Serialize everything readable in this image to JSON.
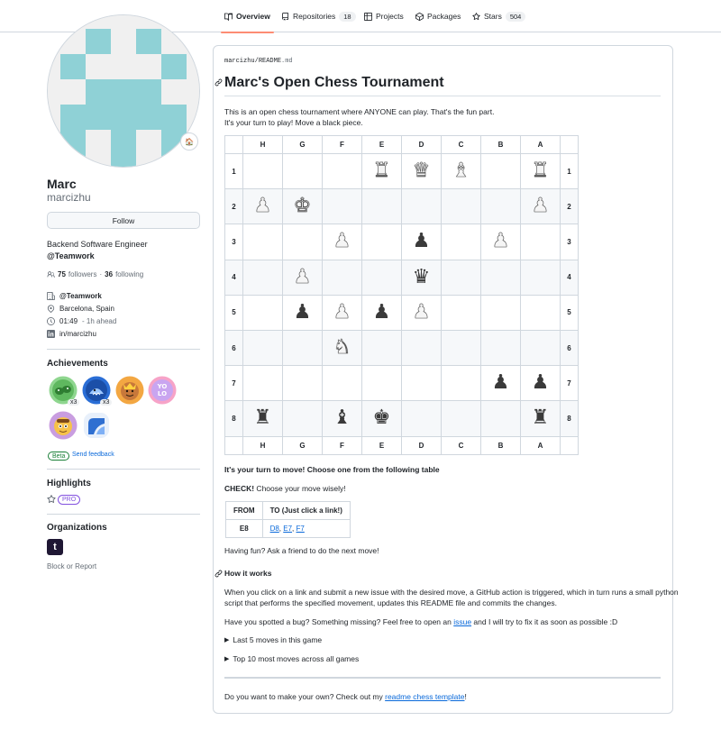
{
  "nav": {
    "tabs": [
      {
        "label": "Overview",
        "count": null
      },
      {
        "label": "Repositories",
        "count": "18"
      },
      {
        "label": "Projects",
        "count": null
      },
      {
        "label": "Packages",
        "count": null
      },
      {
        "label": "Stars",
        "count": "504"
      }
    ]
  },
  "profile": {
    "avatar_emoji": "🏠",
    "name": "Marc",
    "login": "marcizhu",
    "follow_label": "Follow",
    "bio_line1": "Backend Software Engineer",
    "bio_line2": "@Teamwork",
    "followers_count": "75",
    "followers_label": "followers",
    "dot": "·",
    "following_count": "36",
    "following_label": "following",
    "company": "@Teamwork",
    "location": "Barcelona, Spain",
    "time": "01:49",
    "time_note": "- 1h ahead",
    "linkedin": "in/marcizhu"
  },
  "achievements": {
    "title": "Achievements",
    "badges": [
      {
        "name": "pair-extraordinaire",
        "count": "x3"
      },
      {
        "name": "pull-shark",
        "count": "x3"
      },
      {
        "name": "starstruck",
        "count": null
      },
      {
        "name": "yolo",
        "count": null
      },
      {
        "name": "quickdraw",
        "count": null
      },
      {
        "name": "arctic-code-vault",
        "count": null
      }
    ],
    "beta_label": "Beta",
    "feedback_label": "Send feedback"
  },
  "highlights": {
    "title": "Highlights",
    "pro_label": "PRO"
  },
  "organizations": {
    "title": "Organizations",
    "org_initial": "t",
    "block_label": "Block or Report"
  },
  "readme": {
    "path_user": "marcizhu",
    "path_sep": "/",
    "path_file": "README",
    "path_ext": ".md",
    "title": "Marc's Open Chess Tournament",
    "intro1": "This is an open chess tournament where ANYONE can play. That's the fun part.",
    "intro2": "It's your turn to play! Move a black piece.",
    "board": {
      "columns": [
        "H",
        "G",
        "F",
        "E",
        "D",
        "C",
        "B",
        "A"
      ],
      "rows": [
        {
          "rank": "1",
          "cells": [
            "",
            "",
            "",
            "wR",
            "wQ",
            "wB",
            "",
            "wR"
          ]
        },
        {
          "rank": "2",
          "cells": [
            "wP",
            "wK",
            "",
            "",
            "",
            "",
            "",
            "wP"
          ]
        },
        {
          "rank": "3",
          "cells": [
            "",
            "",
            "wP",
            "",
            "bP",
            "",
            "wP",
            ""
          ]
        },
        {
          "rank": "4",
          "cells": [
            "",
            "wP",
            "",
            "",
            "bQ",
            "",
            "",
            ""
          ]
        },
        {
          "rank": "5",
          "cells": [
            "",
            "bP",
            "wP",
            "bP",
            "wP",
            "",
            "",
            ""
          ]
        },
        {
          "rank": "6",
          "cells": [
            "",
            "",
            "wN",
            "",
            "",
            "",
            "",
            ""
          ]
        },
        {
          "rank": "7",
          "cells": [
            "",
            "",
            "",
            "",
            "",
            "",
            "bP",
            "bP"
          ]
        },
        {
          "rank": "8",
          "cells": [
            "bR",
            "",
            "bB",
            "bK",
            "",
            "",
            "",
            "bR"
          ]
        }
      ]
    },
    "turn_heading": "It's your turn to move! Choose one from the following table",
    "check_bold": "CHECK!",
    "check_text": " Choose your move wisely!",
    "move_table": {
      "col_from": "FROM",
      "col_to": "TO (Just click a link!)",
      "rows": [
        {
          "from": "E8",
          "to": [
            "D8",
            "E7",
            "F7"
          ]
        }
      ]
    },
    "fun_text": "Having fun? Ask a friend to do the next move!",
    "how_title": "How it works",
    "how_text1": "When you click on a link and submit a new issue with the desired move, a GitHub action is triggered, which in turn runs a small python",
    "how_text2": "script that performs the specified movement, updates this README file and commits the changes.",
    "bug_pre": "Have you spotted a bug? Something missing? Feel free to open an ",
    "bug_link": "issue",
    "bug_post": " and I will try to fix it as soon as possible :D",
    "details1": "Last 5 moves in this game",
    "details2": "Top 10 most moves across all games",
    "own_pre": "Do you want to make your own? Check out my ",
    "own_link": "readme chess template",
    "own_post": "!"
  }
}
